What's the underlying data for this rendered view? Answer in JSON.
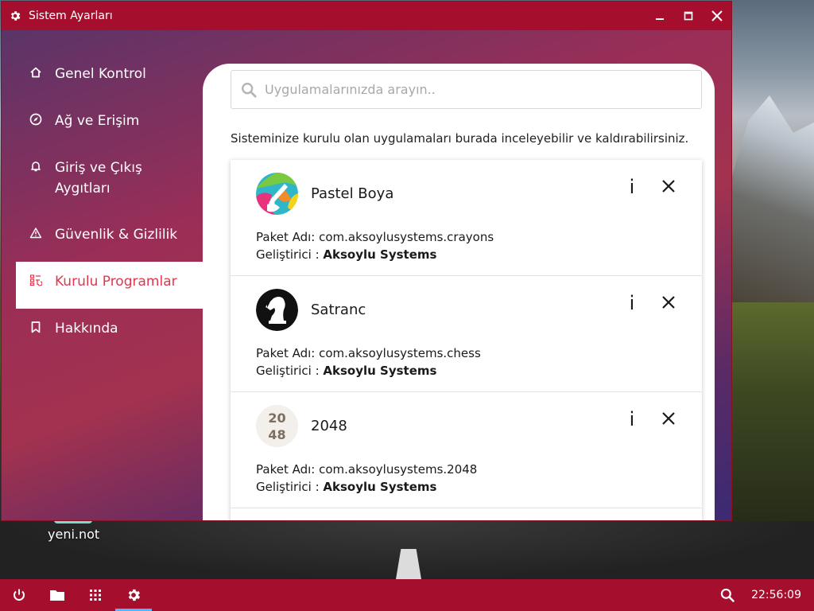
{
  "window": {
    "title": "Sistem Ayarları",
    "title_icon": "gear-icon",
    "controls": [
      "minimize-icon",
      "maximize-icon",
      "close-icon"
    ]
  },
  "sidebar": {
    "items": [
      {
        "label": "Genel Kontrol",
        "icon": "home-icon",
        "active": false
      },
      {
        "label": "Ağ ve Erişim",
        "icon": "compass-icon",
        "active": false
      },
      {
        "label": "Giriş ve Çıkış Aygıtları",
        "icon": "bell-icon",
        "active": false
      },
      {
        "label": "Güvenlik & Gizlilik",
        "icon": "warning-icon",
        "active": false
      },
      {
        "label": "Kurulu Programlar",
        "icon": "apps-icon",
        "active": true
      },
      {
        "label": "Hakkında",
        "icon": "bookmark-icon",
        "active": false
      }
    ]
  },
  "search": {
    "placeholder": "Uygulamalarınızda arayın..",
    "value": ""
  },
  "description": "Sisteminize kurulu olan uygulamaları burada inceleyebilir ve kaldırabilirsiniz.",
  "apps": [
    {
      "name": "Pastel Boya",
      "package_label": "Paket Adı:",
      "package": "com.aksoylusystems.crayons",
      "dev_label": "Geliştirici :",
      "developer": "Aksoylu Systems",
      "info_label": "i"
    },
    {
      "name": "Satranc",
      "package_label": "Paket Adı:",
      "package": "com.aksoylusystems.chess",
      "dev_label": "Geliştirici :",
      "developer": "Aksoylu Systems",
      "info_label": "i"
    },
    {
      "name": "2048",
      "package_label": "Paket Adı:",
      "package": "com.aksoylusystems.2048",
      "dev_label": "Geliştirici :",
      "developer": "Aksoylu Systems",
      "info_label": "i",
      "icon_text_top": "20",
      "icon_text_bottom": "48"
    }
  ],
  "desktop": {
    "icon_label": "yeni.not"
  },
  "taskbar": {
    "buttons": [
      "power-icon",
      "folder-icon",
      "grid-icon",
      "settings-icon"
    ],
    "active_button": "settings-icon",
    "clock": "22:56:09"
  },
  "colors": {
    "accent": "#a50f2d",
    "active_nav_text": "#e0374f",
    "taskbar_indicator": "#4fb6ff"
  }
}
